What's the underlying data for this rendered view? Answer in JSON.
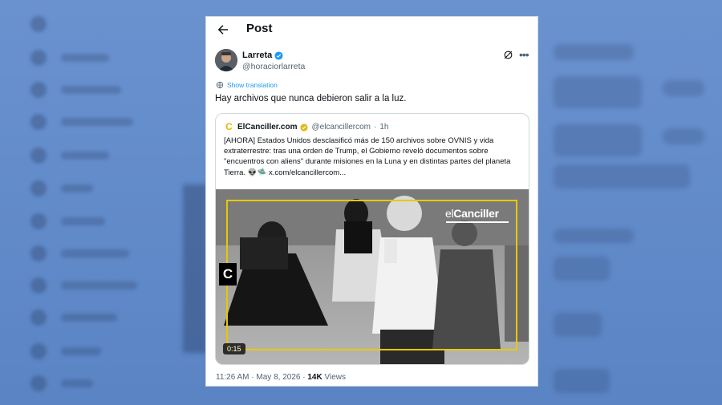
{
  "header": {
    "title": "Post"
  },
  "post": {
    "author_name": "Larreta",
    "author_handle": "@horaciorlarreta",
    "translate_label": "Show translation",
    "text": "Hay archivos que nunca debieron salir a la luz.",
    "time": "11:26 AM",
    "date": "May 8, 2026",
    "views_count": "14K",
    "views_label": "Views"
  },
  "quote": {
    "logo_letter": "C",
    "name": "ElCanciller.com",
    "handle": "@elcancillercom",
    "separator": "·",
    "time": "1h",
    "text": "[AHORA] Estados Unidos desclasificó más de 150 archivos sobre OVNIS y vida extraterrestre: tras una orden de Trump, el Gobierno reveló documentos sobre \"encuentros con aliens\" durante misiones en la Luna y en distintas partes del planeta Tierra. 👽🛸 x.com/elcancillercom...",
    "video": {
      "brand_prefix": "el",
      "brand_main": "Canciller",
      "side_mark": "C",
      "duration": "0:15"
    }
  },
  "colors": {
    "accent": "#1d9bf0",
    "frame_yellow": "#e8c800",
    "text_primary": "#0f1419",
    "text_secondary": "#536471"
  },
  "icons": [
    "back-arrow-icon",
    "verified-icon",
    "grok-icon",
    "more-icon",
    "globe-icon",
    "gold-badge-icon"
  ]
}
